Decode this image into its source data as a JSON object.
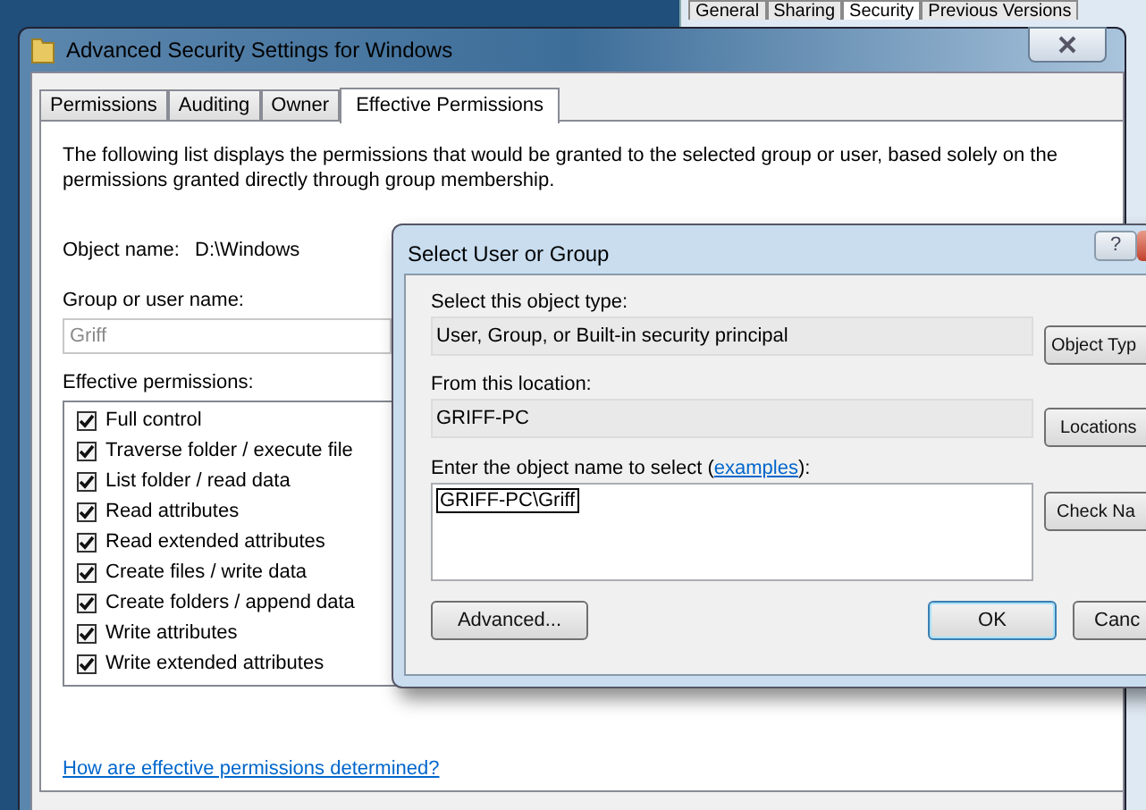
{
  "background_window": {
    "tabs": [
      {
        "label": "General",
        "selected": false
      },
      {
        "label": "Sharing",
        "selected": false
      },
      {
        "label": "Security",
        "selected": true
      },
      {
        "label": "Previous Versions",
        "selected": false
      }
    ]
  },
  "window": {
    "title": "Advanced Security Settings for Windows",
    "tabs": [
      {
        "label": "Permissions",
        "selected": false
      },
      {
        "label": "Auditing",
        "selected": false
      },
      {
        "label": "Owner",
        "selected": false
      },
      {
        "label": "Effective Permissions",
        "selected": true
      }
    ],
    "description": "The following list displays the permissions that would be granted to the selected group or user, based solely on the permissions granted directly through group membership.",
    "object_name": {
      "label": "Object name:",
      "value": "D:\\Windows"
    },
    "group_or_user": {
      "label": "Group or user name:",
      "value": "Griff",
      "disabled": true
    },
    "effective_permissions": {
      "label": "Effective permissions:",
      "items": [
        {
          "label": "Full control",
          "checked": true
        },
        {
          "label": "Traverse folder / execute file",
          "checked": true
        },
        {
          "label": "List folder / read data",
          "checked": true
        },
        {
          "label": "Read attributes",
          "checked": true
        },
        {
          "label": "Read extended attributes",
          "checked": true
        },
        {
          "label": "Create files / write data",
          "checked": true
        },
        {
          "label": "Create folders / append data",
          "checked": true
        },
        {
          "label": "Write attributes",
          "checked": true
        },
        {
          "label": "Write extended attributes",
          "checked": true
        }
      ]
    },
    "help_link": "How are effective permissions determined?"
  },
  "dialog": {
    "title": "Select User or Group",
    "help_button": "?",
    "object_type": {
      "label": "Select this object type:",
      "value": "User, Group, or Built-in security principal",
      "button": "Object Typ"
    },
    "location": {
      "label": "From this location:",
      "value": "GRIFF-PC",
      "button": "Locations"
    },
    "object_names": {
      "label": "Enter the object name to select (",
      "link": "examples",
      "label_end": "):",
      "value": "GRIFF-PC\\Griff",
      "button": "Check Na"
    },
    "buttons": [
      {
        "label": "Advanced...",
        "default": false
      },
      {
        "label": "OK",
        "default": true
      },
      {
        "label": "Canc",
        "default": false
      }
    ]
  }
}
